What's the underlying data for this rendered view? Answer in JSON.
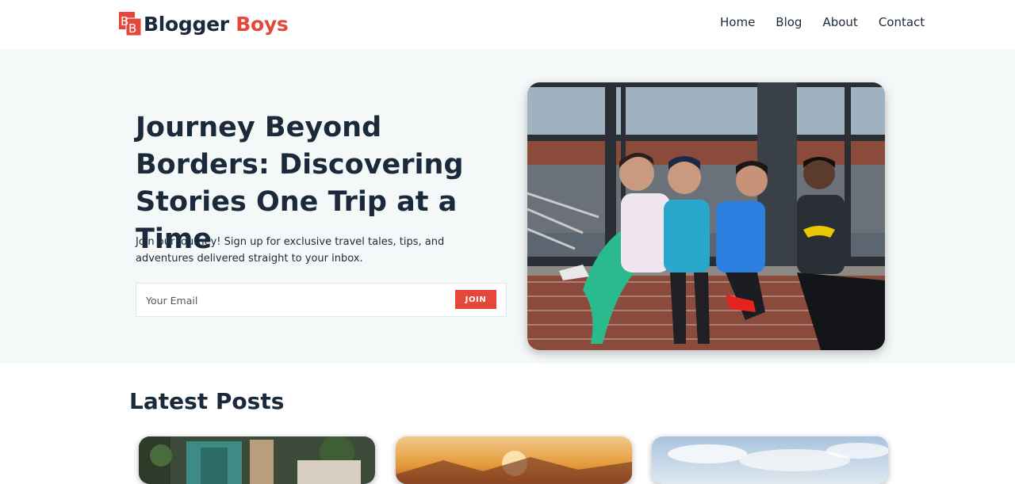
{
  "header": {
    "logo_icon": "bb-logo-icon",
    "brand_first": "Blogger",
    "brand_second": "Boys",
    "nav": [
      "Home",
      "Blog",
      "About",
      "Contact"
    ]
  },
  "hero": {
    "title": "Journey Beyond Borders: Discovering Stories One Trip at a Time",
    "subtitle": "Join our journey! Sign up for exclusive travel tales, tips, and adventures delivered straight to your inbox.",
    "email_placeholder": "Your Email",
    "join_label": "JOIN",
    "image": "four-friends-sitting-on-brick-wall-photo"
  },
  "latest_posts": {
    "title": "Latest Posts",
    "cards": [
      {
        "image": "courtyard-with-plants-photo"
      },
      {
        "image": "sunset-mountains-photo"
      },
      {
        "image": "cloudy-sky-photo"
      }
    ]
  },
  "colors": {
    "accent": "#e5473b",
    "text": "#1b2a3a",
    "hero_bg": "#f5f8f8"
  }
}
